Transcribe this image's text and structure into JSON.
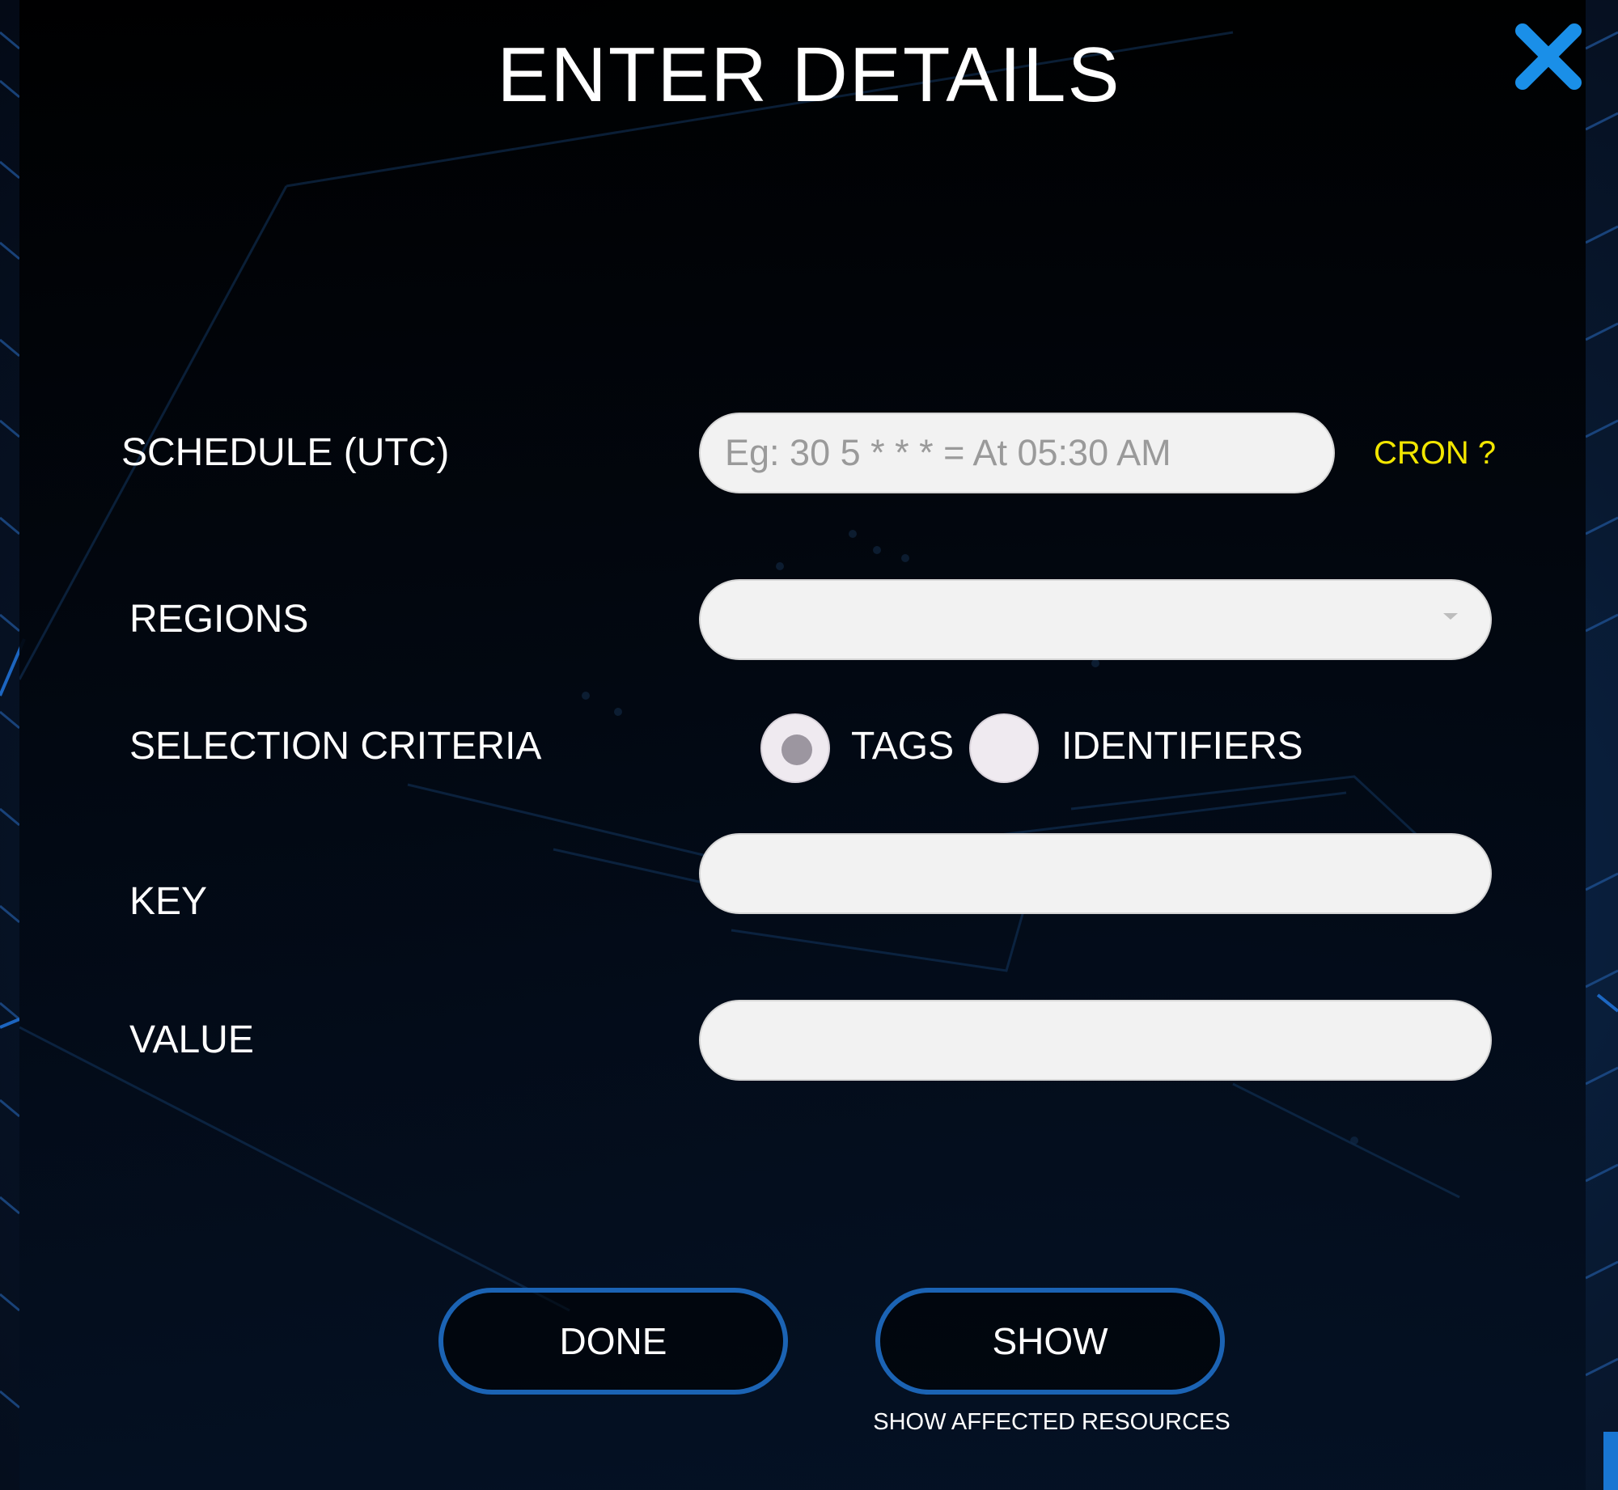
{
  "dialog": {
    "title": "ENTER DETAILS",
    "close_icon": "close-icon",
    "accent_color": "#1b63b4",
    "close_color": "#1a8fe8"
  },
  "schedule": {
    "label": "SCHEDULE (UTC)",
    "value": "",
    "placeholder": "Eg: 30 5 * * * = At 05:30 AM",
    "help_link": "CRON ?",
    "help_color": "#f2e600"
  },
  "regions": {
    "label": "REGIONS",
    "selected": ""
  },
  "selection_criteria": {
    "label": "SELECTION CRITERIA",
    "options": [
      "TAGS",
      "IDENTIFIERS"
    ],
    "selected": "TAGS"
  },
  "key": {
    "label": "KEY",
    "value": ""
  },
  "value_field": {
    "label": "VALUE",
    "value": ""
  },
  "buttons": {
    "done": "DONE",
    "show": "SHOW",
    "show_hint": "SHOW AFFECTED RESOURCES"
  }
}
